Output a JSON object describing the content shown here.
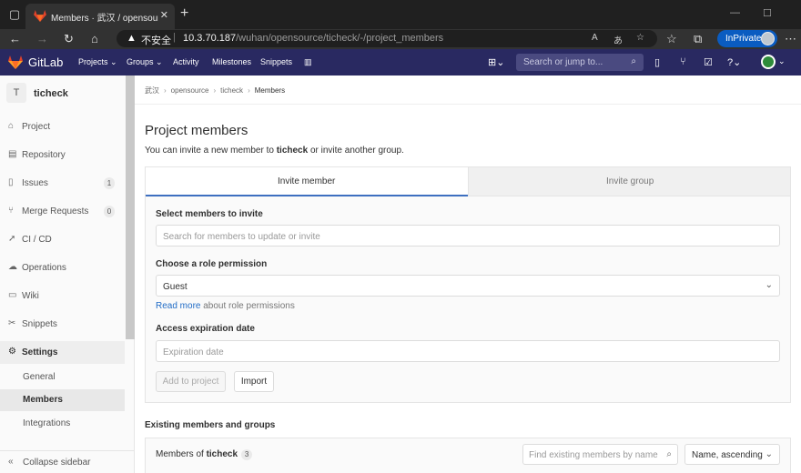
{
  "browser": {
    "tab_title": "Members · 武汉 / opensource / ti",
    "insecure_label": "不安全",
    "url_host": "10.3.70.187",
    "url_path": "/wuhan/opensource/ticheck/-/project_members",
    "inprivate_label": "InPrivate"
  },
  "header": {
    "brand": "GitLab",
    "nav": [
      "Projects",
      "Groups",
      "Activity",
      "Milestones",
      "Snippets"
    ],
    "search_placeholder": "Search or jump to..."
  },
  "sidebar": {
    "project_initial": "T",
    "project_name": "ticheck",
    "items": [
      {
        "label": "Project",
        "icon": "home-icon"
      },
      {
        "label": "Repository",
        "icon": "repository-icon"
      },
      {
        "label": "Issues",
        "icon": "issues-icon",
        "badge": "1"
      },
      {
        "label": "Merge Requests",
        "icon": "merge-request-icon",
        "badge": "0"
      },
      {
        "label": "CI / CD",
        "icon": "rocket-icon"
      },
      {
        "label": "Operations",
        "icon": "cloud-gear-icon"
      },
      {
        "label": "Wiki",
        "icon": "book-icon"
      },
      {
        "label": "Snippets",
        "icon": "snippet-icon"
      },
      {
        "label": "Settings",
        "icon": "settings-icon"
      }
    ],
    "settings_sub": [
      "General",
      "Members",
      "Integrations"
    ],
    "collapse_label": "Collapse sidebar"
  },
  "breadcrumb": [
    "武汉",
    "opensource",
    "ticheck",
    "Members"
  ],
  "page": {
    "title": "Project members",
    "desc_prefix": "You can invite a new member to ",
    "desc_project": "ticheck",
    "desc_suffix": " or invite another group."
  },
  "invite": {
    "tab_member": "Invite member",
    "tab_group": "Invite group",
    "select_label": "Select members to invite",
    "select_placeholder": "Search for members to update or invite",
    "role_label": "Choose a role permission",
    "role_value": "Guest",
    "read_more": "Read more",
    "read_more_suffix": " about role permissions",
    "expiry_label": "Access expiration date",
    "expiry_placeholder": "Expiration date",
    "add_button": "Add to project",
    "import_button": "Import"
  },
  "existing": {
    "heading": "Existing members and groups",
    "members_of": "Members of ",
    "project": "ticheck",
    "count": "3",
    "search_placeholder": "Find existing members by name",
    "sort_value": "Name, ascending"
  }
}
